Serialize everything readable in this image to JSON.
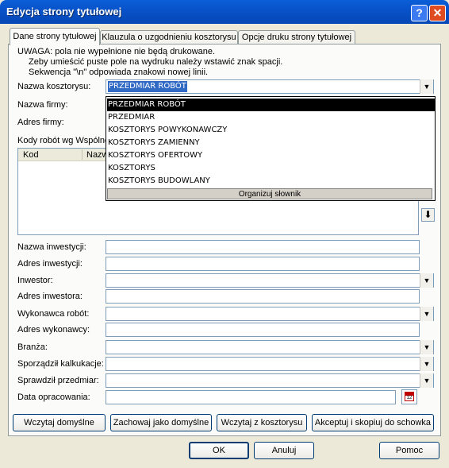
{
  "window": {
    "title": "Edycja strony tytułowej",
    "help_glyph": "?",
    "close_glyph": "✕"
  },
  "tabs": [
    {
      "label": "Dane strony tytułowej",
      "active": true
    },
    {
      "label": "Klauzula o uzgodnieniu kosztorysu",
      "active": false
    },
    {
      "label": "Opcje druku strony tytułowej",
      "active": false
    }
  ],
  "notice": {
    "line1": "UWAGA:   pola nie wypełnione nie będą drukowane.",
    "line2": "Zeby umieścić puste pole na wydruku należy wstawić znak spacji.",
    "line3": "Sekwencja \"\\n\" odpowiada znakowi nowej linii."
  },
  "fields": {
    "nazwa_kosztorysu": {
      "label": "Nazwa kosztorysu:",
      "value": "PRZEDMIAR ROBÓT"
    },
    "nazwa_firmy": {
      "label": "Nazwa firmy:"
    },
    "adres_firmy": {
      "label": "Adres firmy:"
    },
    "kody": {
      "label": "Kody robót wg Wspólne"
    },
    "nazwa_inwestycji": {
      "label": "Nazwa inwestycji:"
    },
    "adres_inwestycji": {
      "label": "Adres inwestycji:"
    },
    "inwestor": {
      "label": "Inwestor:"
    },
    "adres_inwestora": {
      "label": "Adres inwestora:"
    },
    "wykonawca": {
      "label": "Wykonawca robót:"
    },
    "adres_wykonawcy": {
      "label": "Adres wykonawcy:"
    },
    "branza": {
      "label": "Branża:"
    },
    "sporzadzil": {
      "label": "Sporządził kalkukacje:"
    },
    "sprawdzil": {
      "label": "Sprawdził przedmiar:"
    },
    "data": {
      "label": "Data opracowania:"
    }
  },
  "list": {
    "columns": [
      "Kod",
      "Nazw"
    ]
  },
  "dropdown": {
    "options": [
      "PRZEDMIAR ROBÓT",
      "PRZEDMIAR",
      "KOSZTORYS POWYKONAWCZY",
      "KOSZTORYS ZAMIENNY",
      "KOSZTORYS OFERTOWY",
      "KOSZTORYS",
      "KOSZTORYS BUDOWLANY"
    ],
    "footer_button": "Organizuj słownik"
  },
  "actions": {
    "load_default": "Wczytaj domyślne",
    "save_default": "Zachowaj jako domyślne",
    "load_from": "Wczytaj z kosztorysu",
    "accept_copy": "Akceptuj i skopiuj do schowka"
  },
  "footer": {
    "ok": "OK",
    "cancel": "Anuluj",
    "help": "Pomoc"
  },
  "icons": {
    "calendar": "calendar-icon",
    "arrow_down": "arrow-down-icon",
    "combo": "chevron-down-icon"
  }
}
